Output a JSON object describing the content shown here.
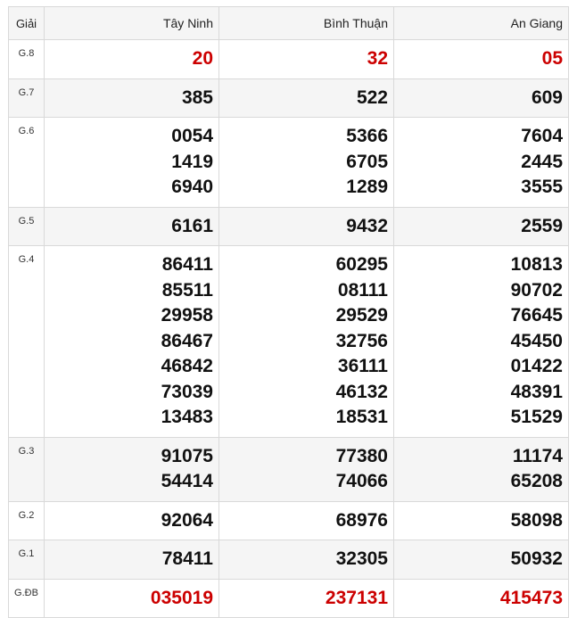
{
  "header": {
    "prize_label": "Giải",
    "provinces": [
      "Tây Ninh",
      "Bình Thuận",
      "An Giang"
    ]
  },
  "prizes": [
    {
      "label": "G.8",
      "values": [
        [
          "20"
        ],
        [
          "32"
        ],
        [
          "05"
        ]
      ],
      "highlight": true
    },
    {
      "label": "G.7",
      "values": [
        [
          "385"
        ],
        [
          "522"
        ],
        [
          "609"
        ]
      ]
    },
    {
      "label": "G.6",
      "values": [
        [
          "0054",
          "1419",
          "6940"
        ],
        [
          "5366",
          "6705",
          "1289"
        ],
        [
          "7604",
          "2445",
          "3555"
        ]
      ]
    },
    {
      "label": "G.5",
      "values": [
        [
          "6161"
        ],
        [
          "9432"
        ],
        [
          "2559"
        ]
      ]
    },
    {
      "label": "G.4",
      "values": [
        [
          "86411",
          "85511",
          "29958",
          "86467",
          "46842",
          "73039",
          "13483"
        ],
        [
          "60295",
          "08111",
          "29529",
          "32756",
          "36111",
          "46132",
          "18531"
        ],
        [
          "10813",
          "90702",
          "76645",
          "45450",
          "01422",
          "48391",
          "51529"
        ]
      ]
    },
    {
      "label": "G.3",
      "values": [
        [
          "91075",
          "54414"
        ],
        [
          "77380",
          "74066"
        ],
        [
          "11174",
          "65208"
        ]
      ]
    },
    {
      "label": "G.2",
      "values": [
        [
          "92064"
        ],
        [
          "68976"
        ],
        [
          "58098"
        ]
      ]
    },
    {
      "label": "G.1",
      "values": [
        [
          "78411"
        ],
        [
          "32305"
        ],
        [
          "50932"
        ]
      ]
    },
    {
      "label": "G.ĐB",
      "values": [
        [
          "035019"
        ],
        [
          "237131"
        ],
        [
          "415473"
        ]
      ],
      "highlight": true
    }
  ],
  "colors": {
    "highlight": "#cc0000",
    "text": "#111111",
    "row_shade": "#f5f5f5",
    "border": "#d9d9d9"
  }
}
